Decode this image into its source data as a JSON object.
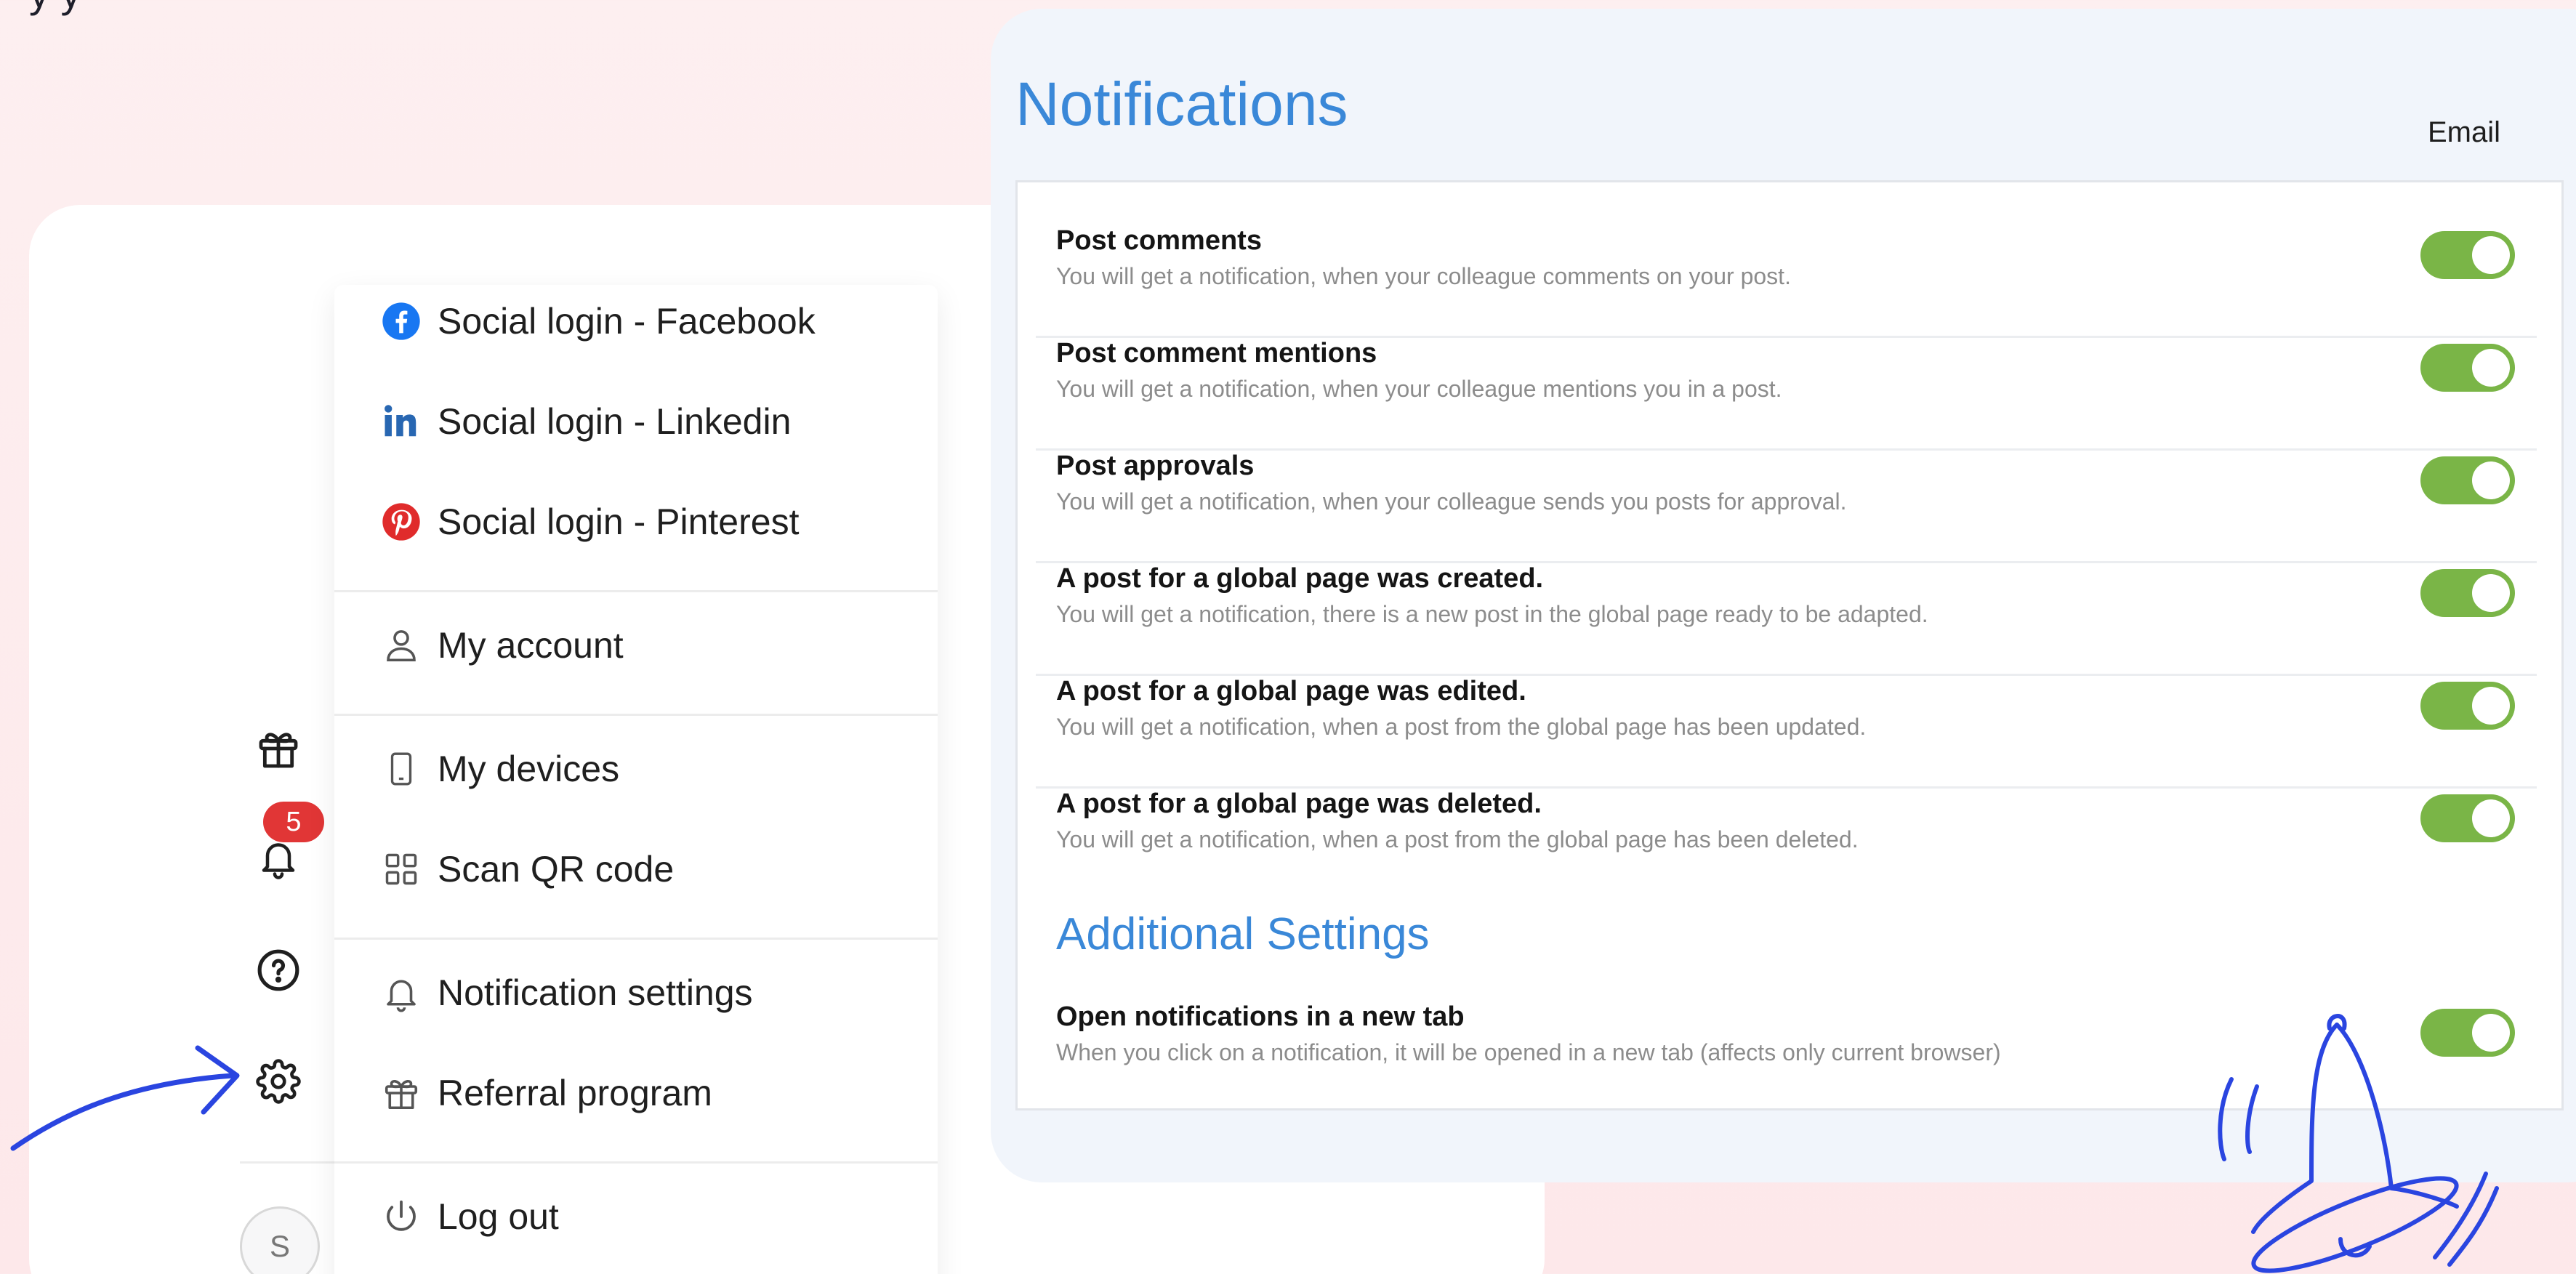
{
  "page": {
    "top_text": "y y"
  },
  "menu": {
    "items": [
      {
        "label": "Social login - Facebook",
        "icon": "facebook-icon"
      },
      {
        "label": "Social login - Linkedin",
        "icon": "linkedin-icon"
      },
      {
        "label": "Social login - Pinterest",
        "icon": "pinterest-icon"
      },
      {
        "label": "My account",
        "icon": "user-icon"
      },
      {
        "label": "My devices",
        "icon": "phone-icon"
      },
      {
        "label": "Scan QR code",
        "icon": "qr-grid-icon"
      },
      {
        "label": "Notification settings",
        "icon": "bell-icon"
      },
      {
        "label": "Referral program",
        "icon": "gift-icon"
      },
      {
        "label": "Log out",
        "icon": "power-icon"
      }
    ]
  },
  "rail": {
    "badge_count": "5",
    "avatar_initial": "S",
    "icons": [
      "gift-icon",
      "bell-icon",
      "help-icon",
      "gear-icon"
    ]
  },
  "notifications": {
    "title": "Notifications",
    "column_email": "Email",
    "rows": [
      {
        "title": "Post comments",
        "desc": "You will get a notification, when your colleague comments on your post.",
        "enabled": true
      },
      {
        "title": "Post comment mentions",
        "desc": "You will get a notification, when your colleague mentions you in a post.",
        "enabled": true
      },
      {
        "title": "Post approvals",
        "desc": "You will get a notification, when your colleague sends you posts for approval.",
        "enabled": true
      },
      {
        "title": "A post for a global page was created.",
        "desc": "You will get a notification, there is a new post in the global page ready to be adapted.",
        "enabled": true
      },
      {
        "title": "A post for a global page was edited.",
        "desc": "You will get a notification, when a post from the global page has been updated.",
        "enabled": true
      },
      {
        "title": "A post for a global page was deleted.",
        "desc": "You will get a notification, when a post from the global page has been deleted.",
        "enabled": true
      }
    ],
    "additional_title": "Additional Settings",
    "additional_rows": [
      {
        "title": "Open notifications in a new tab",
        "desc": "When you click on a notification, it will be opened in a new tab (affects only current browser)",
        "enabled": true
      }
    ]
  },
  "colors": {
    "accent_blue": "#3a88d8",
    "toggle_on": "#7ab547",
    "badge_red": "#e13636",
    "doodle_blue": "#2a45e0"
  }
}
